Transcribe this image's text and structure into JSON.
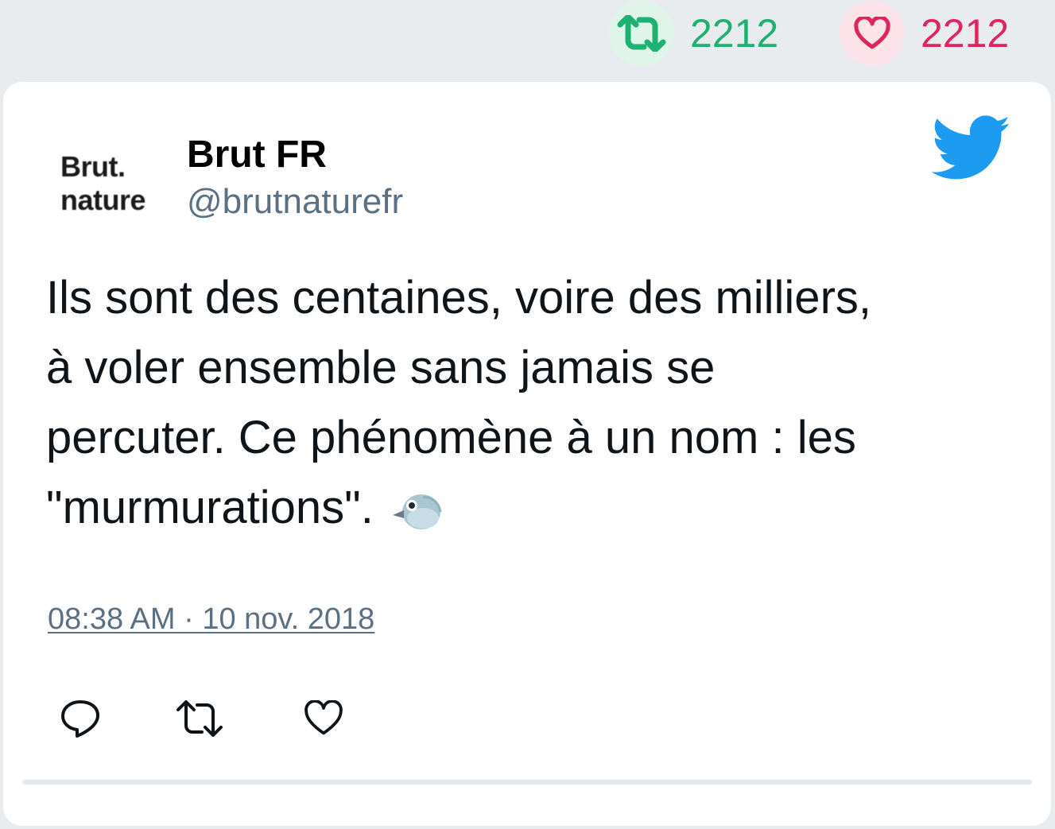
{
  "header": {
    "retweet_count": "2212",
    "like_count": "2212"
  },
  "tweet": {
    "avatar": {
      "line1": "Brut.",
      "line2": "nature"
    },
    "author_name": "Brut FR",
    "author_handle": "@brutnaturefr",
    "text_line1": "Ils sont des centaines, voire des milliers,",
    "text_line2": "à voler ensemble sans jamais se",
    "text_line3": "percuter. Ce phénomène à un nom : les",
    "text_line4": "\"murmurations\".",
    "emoji": "bird-emoji",
    "timestamp": "08:38 AM · 10 nov. 2018"
  },
  "icons": {
    "retweet": "retweet-icon",
    "like": "heart-icon",
    "reply": "reply-icon",
    "logo": "twitter-bird-icon"
  },
  "colors": {
    "retweet_green": "#1db272",
    "like_red": "#e0245e",
    "twitter_blue": "#1d9bf0",
    "muted_text": "#5b7083",
    "page_background": "#e9ecef"
  }
}
